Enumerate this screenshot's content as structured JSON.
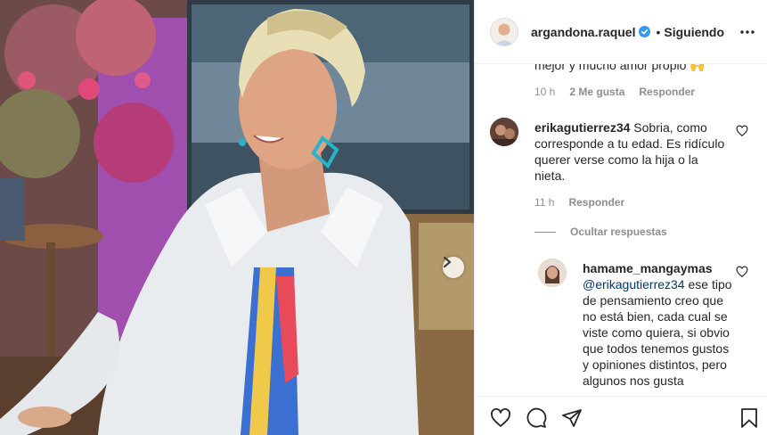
{
  "post": {
    "carousel": {
      "next_icon": "chevron-right-icon"
    }
  },
  "header": {
    "username": "argandona.raquel",
    "verified_icon": "verified-badge-icon",
    "separator": "•",
    "follow_state": "Siguiendo",
    "more_icon": "more-options-icon"
  },
  "comments": {
    "truncated_text": "mejor y mucho amor propio 🙌",
    "first_meta": {
      "time": "10 h",
      "likes": "2 Me gusta",
      "reply": "Responder"
    },
    "second": {
      "username": "erikagutierrez34",
      "text": "Sobria, como corresponde a tu edad. Es ridículo querer verse como la hija o la nieta.",
      "time": "11 h",
      "reply": "Responder"
    },
    "hide_replies": "Ocultar respuestas",
    "reply": {
      "username": "hamame_mangaymas",
      "mention": "@erikagutierrez34",
      "text": "ese tipo de pensamiento creo que no está bien, cada cual se viste como quiera, si obvio que todos tenemos gustos y opiniones distintos, pero algunos nos gusta"
    }
  },
  "actions": {
    "like_icon": "heart-icon",
    "comment_icon": "comment-icon",
    "share_icon": "share-icon",
    "save_icon": "bookmark-icon"
  },
  "colors": {
    "text": "#262626",
    "muted": "#8e8e8e",
    "mention": "#00376b",
    "verified": "#3897f0",
    "border": "#efefef"
  }
}
